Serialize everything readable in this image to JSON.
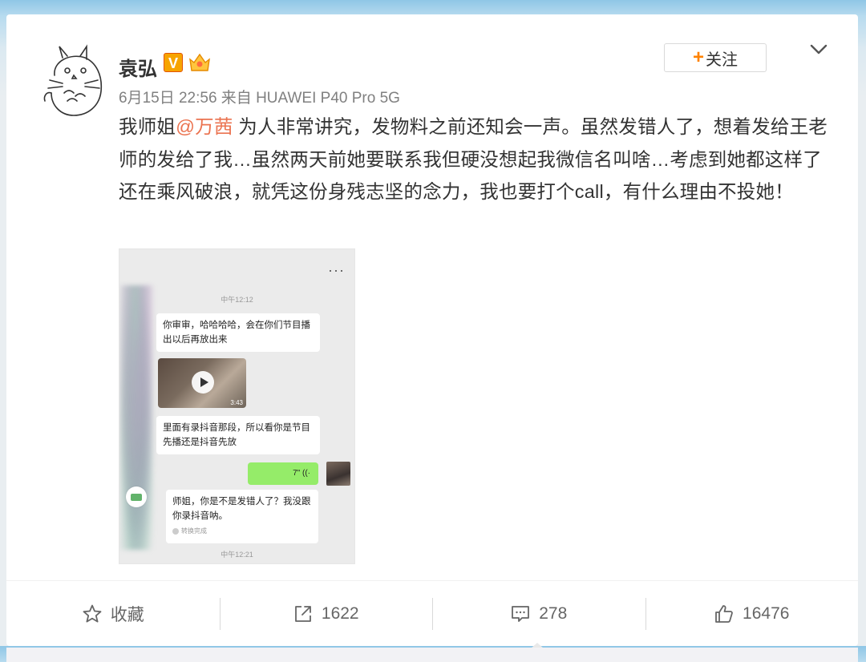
{
  "post": {
    "username": "袁弘",
    "verified_badge": "V",
    "follow_button": {
      "plus": "+",
      "label": "关注"
    },
    "meta": "6月15日 22:56 来自 HUAWEI P40 Pro 5G",
    "text_before_mention": "我师姐",
    "mention": "@万茜",
    "text_after_mention": " 为人非常讲究，发物料之前还知会一声。虽然发错人了，想着发给王老师的发给了我…虽然两天前她要联系我但硬没想起我微信名叫啥…考虑到她都这样了还在乘风破浪，就凭这份身残志坚的念力，我也要打个call，有什么理由不投她！"
  },
  "screenshot": {
    "menu_dots": "···",
    "time_top": "中午12:12",
    "bubble1": "你审审，哈哈哈哈，会在你们节目播出以后再放出来",
    "video_duration": "3:43",
    "bubble2": "里面有录抖音那段，所以看你是节目先播还是抖音先放",
    "voice_label": "7\" ((·",
    "bubble3": "师姐，你是不是发错人了？我没跟你录抖音呐。",
    "transcribed": "转换完成",
    "time_bottom": "中午12:21"
  },
  "actions": {
    "favorite": {
      "icon": "star-icon",
      "label": "收藏"
    },
    "repost": {
      "icon": "share-icon",
      "label": "1622"
    },
    "comment": {
      "icon": "comment-icon",
      "label": "278"
    },
    "like": {
      "icon": "thumbs-up-icon",
      "label": "16476"
    }
  },
  "colors": {
    "mention": "#eb7350",
    "follow_plus": "#ff8200",
    "voice_bubble": "#95ec69"
  }
}
